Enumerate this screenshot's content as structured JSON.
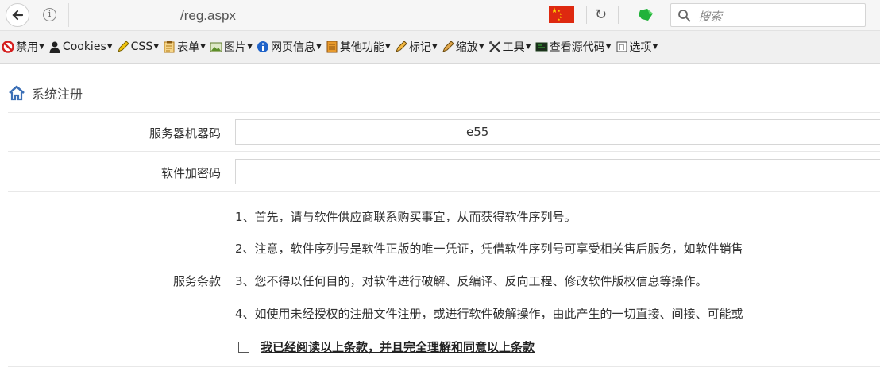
{
  "browser": {
    "url": "/reg.aspx",
    "search_placeholder": "搜索"
  },
  "toolbar": {
    "items": [
      {
        "label": "禁用",
        "icon": "disable-icon"
      },
      {
        "label": "Cookies",
        "icon": "user-icon"
      },
      {
        "label": "CSS",
        "icon": "pencil-icon"
      },
      {
        "label": "表单",
        "icon": "form-icon"
      },
      {
        "label": "图片",
        "icon": "image-icon"
      },
      {
        "label": "网页信息",
        "icon": "info-icon"
      },
      {
        "label": "其他功能",
        "icon": "misc-icon"
      },
      {
        "label": "标记",
        "icon": "marker-icon"
      },
      {
        "label": "缩放",
        "icon": "resize-icon"
      },
      {
        "label": "工具",
        "icon": "tools-icon"
      },
      {
        "label": "查看源代码",
        "icon": "source-icon"
      },
      {
        "label": "选项",
        "icon": "options-icon"
      }
    ]
  },
  "page": {
    "title": "系统注册",
    "server_code_label": "服务器机器码",
    "server_code_value": "e55",
    "software_key_label": "软件加密码",
    "software_key_value": "",
    "terms_label": "服务条款",
    "terms": [
      "1、首先，请与软件供应商联系购买事宜，从而获得软件序列号。",
      "2、注意，软件序列号是软件正版的唯一凭证，凭借软件序列号可享受相关售后服务，如软件销售",
      "3、您不得以任何目的，对软件进行破解、反编译、反向工程、修改软件版权信息等操作。",
      "4、如使用未经授权的注册文件注册，或进行软件破解操作，由此产生的一切直接、间接、可能或"
    ],
    "agree_text": "我已经阅读以上条款，并且完全理解和同意以上条款"
  },
  "colors": {
    "toolbar_bg": "#f0f0f0",
    "flag_red": "#de2910",
    "home_blue": "#3b6fb6"
  }
}
